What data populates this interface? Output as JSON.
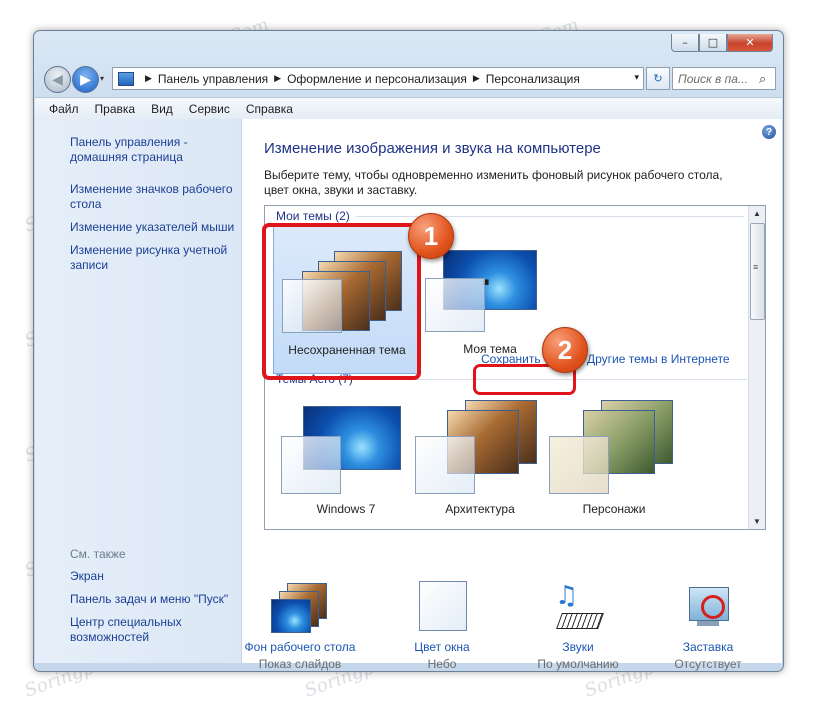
{
  "window": {
    "controls": {
      "minimize": "–",
      "maximize": "□",
      "close": "✕"
    }
  },
  "nav": {
    "back": "◀",
    "forward": "▶",
    "history": "▾"
  },
  "address": {
    "crumbs": [
      "Панель управления",
      "Оформление и персонализация",
      "Персонализация"
    ],
    "separator": "▶",
    "dropdown": "▾"
  },
  "refresh": "↻",
  "search": {
    "placeholder": "Поиск в па...",
    "icon": "⌕"
  },
  "menu": [
    "Файл",
    "Правка",
    "Вид",
    "Сервис",
    "Справка"
  ],
  "sidebar": {
    "home": "Панель управления - домашняя страница",
    "links": [
      "Изменение значков рабочего стола",
      "Изменение указателей мыши",
      "Изменение рисунка учетной записи"
    ],
    "see_also_title": "См. также",
    "see_also": [
      "Экран",
      "Панель задач и меню \"Пуск\"",
      "Центр специальных возможностей"
    ]
  },
  "main": {
    "help": "?",
    "heading": "Изменение изображения и звука на компьютере",
    "description": "Выберите тему, чтобы одновременно изменить фоновый рисунок рабочего стола, цвет окна, звуки и заставку.",
    "my_themes_header": "Мои темы (2)",
    "my_themes": [
      {
        "name": "Несохраненная тема"
      },
      {
        "name": "Моя тема"
      }
    ],
    "save_theme_link": "Сохранить тему",
    "more_themes_link": "Другие темы в Интернете",
    "aero_header": "Темы Aero (7)",
    "aero_themes": [
      {
        "name": "Windows 7"
      },
      {
        "name": "Архитектура"
      },
      {
        "name": "Персонажи"
      }
    ],
    "scroll_up": "▲",
    "scroll_down": "▼",
    "scroll_grip": "≡"
  },
  "settings": [
    {
      "label": "Фон рабочего стола",
      "value": "Показ слайдов"
    },
    {
      "label": "Цвет окна",
      "value": "Небо"
    },
    {
      "label": "Звуки",
      "value": "По умолчанию"
    },
    {
      "label": "Заставка",
      "value": "Отсутствует"
    }
  ],
  "callouts": {
    "badge1": "1",
    "badge2": "2"
  },
  "watermark": "Soringpcrepair.Com",
  "colors": {
    "accent_red": "#e0141b",
    "link_blue": "#1c55b3",
    "heading_blue": "#1e3287"
  }
}
